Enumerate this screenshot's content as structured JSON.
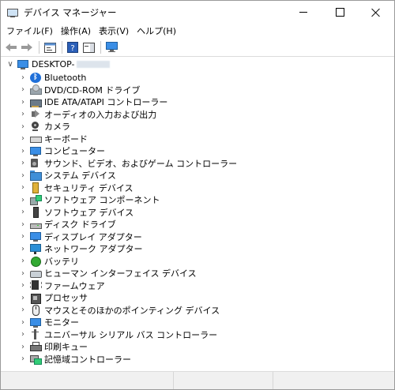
{
  "window": {
    "title": "デバイス マネージャー",
    "icon": "device-manager-icon",
    "controls": [
      "minimize",
      "maximize",
      "close"
    ]
  },
  "menu": [
    {
      "label": "ファイル(F)"
    },
    {
      "label": "操作(A)"
    },
    {
      "label": "表示(V)"
    },
    {
      "label": "ヘルプ(H)"
    }
  ],
  "toolbar": [
    {
      "name": "back-button",
      "icon": "arrow-left-icon",
      "glyph": "⇦"
    },
    {
      "name": "forward-button",
      "icon": "arrow-right-icon",
      "glyph": "⇨"
    },
    {
      "name": "properties-button",
      "icon": "properties-icon",
      "glyph": "▣"
    },
    {
      "name": "help-button",
      "icon": "help-icon",
      "glyph": "?"
    },
    {
      "name": "action-pane-button",
      "icon": "action-pane-icon",
      "glyph": "▤"
    },
    {
      "name": "scan-hardware-button",
      "icon": "monitor-icon",
      "glyph": "▭"
    }
  ],
  "tree": {
    "root": {
      "label": "DESKTOP-",
      "expanded": true,
      "icon": "computer-icon"
    },
    "nodes": [
      {
        "label": "Bluetooth",
        "icon": "bluetooth-icon",
        "cls": "i-bt"
      },
      {
        "label": "DVD/CD-ROM ドライブ",
        "icon": "dvd-drive-icon",
        "cls": "i-disc"
      },
      {
        "label": "IDE ATA/ATAPI コントローラー",
        "icon": "ide-controller-icon",
        "cls": "i-ide"
      },
      {
        "label": "オーディオの入力および出力",
        "icon": "audio-io-icon",
        "cls": "i-audio"
      },
      {
        "label": "カメラ",
        "icon": "camera-icon",
        "cls": "i-cam"
      },
      {
        "label": "キーボード",
        "icon": "keyboard-icon",
        "cls": "i-kb"
      },
      {
        "label": "コンピューター",
        "icon": "computer-icon",
        "cls": "i-mon"
      },
      {
        "label": "サウンド、ビデオ、およびゲーム コントローラー",
        "icon": "sound-icon",
        "cls": "i-sound"
      },
      {
        "label": "システム デバイス",
        "icon": "system-devices-icon",
        "cls": "i-sysdev"
      },
      {
        "label": "セキュリティ デバイス",
        "icon": "security-key-icon",
        "cls": "i-sec"
      },
      {
        "label": "ソフトウェア コンポーネント",
        "icon": "software-component-icon",
        "cls": "i-comp"
      },
      {
        "label": "ソフトウェア デバイス",
        "icon": "software-device-icon",
        "cls": "i-swdev"
      },
      {
        "label": "ディスク ドライブ",
        "icon": "disk-drive-icon",
        "cls": "i-disk"
      },
      {
        "label": "ディスプレイ アダプター",
        "icon": "display-adapter-icon",
        "cls": "i-mon"
      },
      {
        "label": "ネットワーク アダプター",
        "icon": "network-adapter-icon",
        "cls": "i-net"
      },
      {
        "label": "バッテリ",
        "icon": "battery-icon",
        "cls": "i-bat"
      },
      {
        "label": "ヒューマン インターフェイス デバイス",
        "icon": "hid-icon",
        "cls": "i-hid"
      },
      {
        "label": "ファームウェア",
        "icon": "firmware-icon",
        "cls": "i-fw"
      },
      {
        "label": "プロセッサ",
        "icon": "processor-icon",
        "cls": "i-cpu"
      },
      {
        "label": "マウスとそのほかのポインティング デバイス",
        "icon": "mouse-icon",
        "cls": "i-mouse"
      },
      {
        "label": "モニター",
        "icon": "monitor-icon",
        "cls": "i-mon"
      },
      {
        "label": "ユニバーサル シリアル バス コントローラー",
        "icon": "usb-icon",
        "cls": "i-usb"
      },
      {
        "label": "印刷キュー",
        "icon": "printer-icon",
        "cls": "i-print"
      },
      {
        "label": "記憶域コントローラー",
        "icon": "storage-controller-icon",
        "cls": "i-store"
      }
    ]
  },
  "chevrons": {
    "collapsed": "›",
    "expanded": "∨"
  }
}
